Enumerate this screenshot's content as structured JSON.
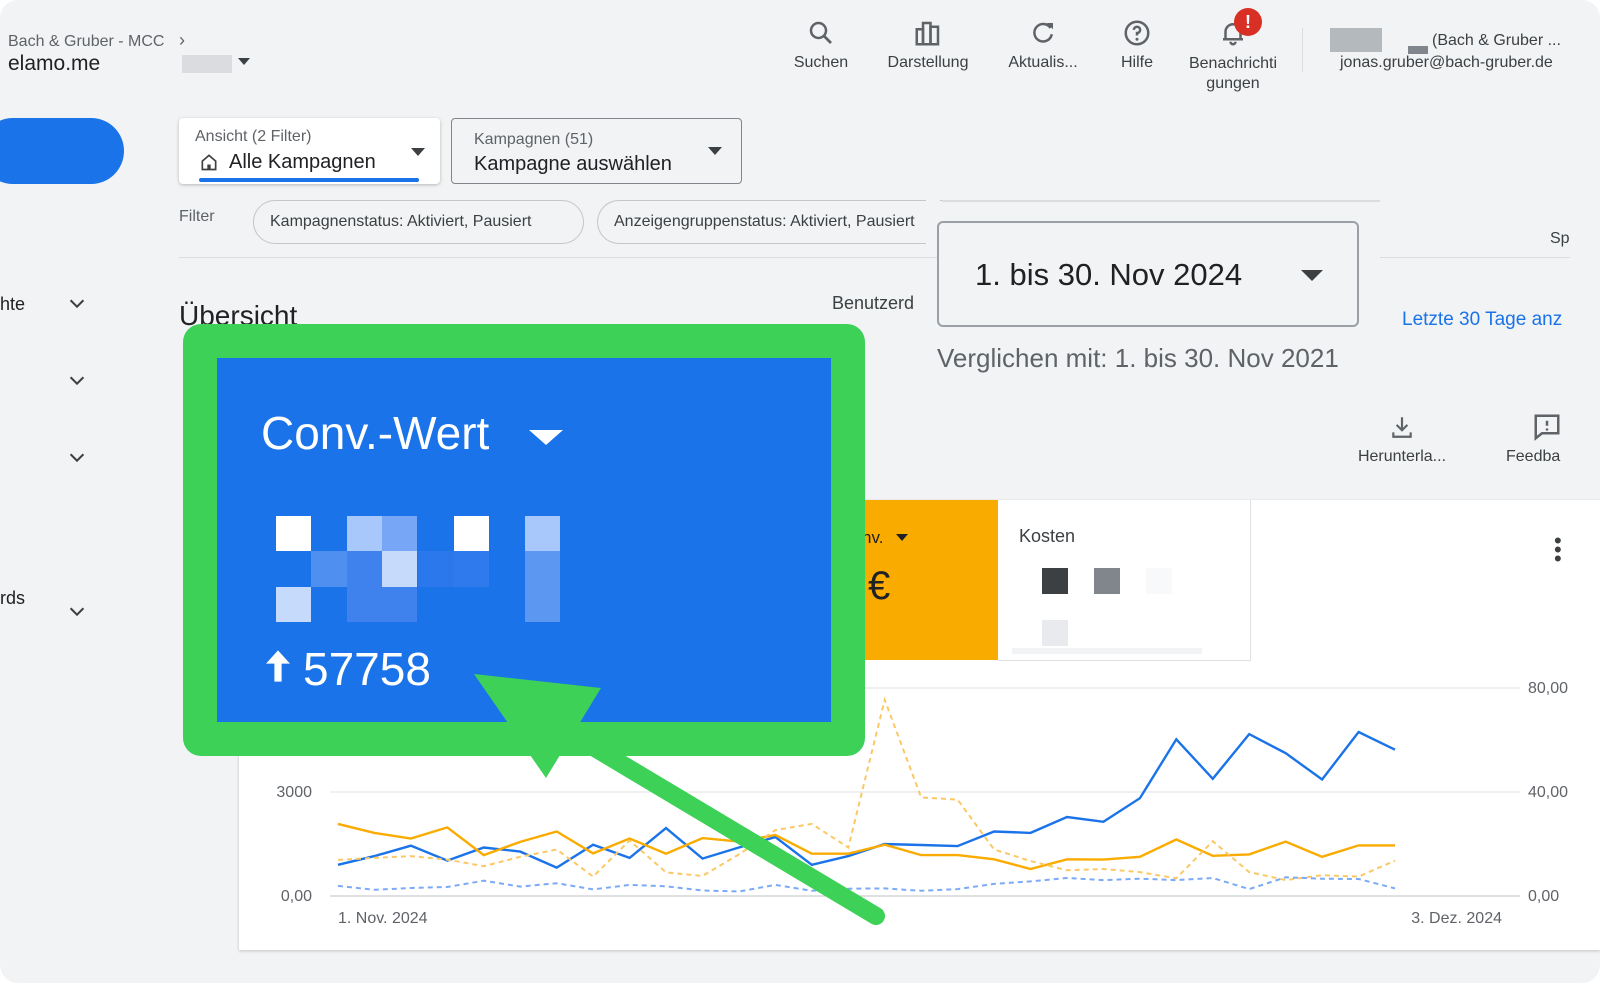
{
  "header": {
    "breadcrumb": "Bach & Gruber - MCC",
    "account": "elamo.me",
    "tools": [
      {
        "label": "Suchen",
        "icon": "search-icon"
      },
      {
        "label": "Darstellung",
        "icon": "appearance-icon"
      },
      {
        "label": "Aktualis...",
        "icon": "refresh-icon"
      },
      {
        "label": "Hilfe",
        "icon": "help-icon"
      },
      {
        "label": "Benachrichti gungen",
        "icon": "bell-icon",
        "badge": "!"
      }
    ],
    "user_name": "(Bach & Gruber ...",
    "user_email": "jonas.gruber@bach-gruber.de"
  },
  "view_select": {
    "label": "Ansicht (2 Filter)",
    "value": "Alle Kampagnen"
  },
  "campaign_select": {
    "label": "Kampagnen (51)",
    "value": "Kampagne auswählen"
  },
  "filter": {
    "label": "Filter",
    "chips": [
      "Kampagnenstatus: Aktiviert, Pausiert",
      "Anzeigengruppenstatus: Aktiviert, Pausiert"
    ],
    "trailing": "Sp"
  },
  "sidebar": {
    "items": [
      "hte",
      "",
      "",
      "rds"
    ]
  },
  "overview": {
    "title": "Übersicht",
    "custom_label": "Benutzerd",
    "date_range": "1. bis 30. Nov 2024",
    "compare": "Verglichen mit: 1. bis 30. Nov 2021",
    "last30_link": "Letzte 30 Tage anz",
    "download": "Herunterla...",
    "feedback": "Feedba"
  },
  "cards": {
    "conv_partial": "nv.",
    "currency": "€",
    "cost_label": "Kosten"
  },
  "highlight": {
    "metric": "Conv.-Wert",
    "delta": "57758"
  },
  "chart_data": {
    "type": "line",
    "x_start_label": "1. Nov. 2024",
    "x_end_label": "3. Dez. 2024",
    "y_left_ticks": [
      "0,00",
      "3000"
    ],
    "y_right_ticks": [
      "0,00",
      "40,00",
      "80,00"
    ],
    "points": 30,
    "series": [
      {
        "color": "#1a73e8",
        "dash": false,
        "values": [
          900,
          1150,
          1450,
          1020,
          1400,
          1280,
          820,
          1480,
          1100,
          1960,
          1080,
          1400,
          1700,
          900,
          1150,
          1500,
          1470,
          1440,
          1860,
          1820,
          2280,
          2140,
          2820,
          4520,
          3380,
          4670,
          4120,
          3360,
          4730,
          4220
        ]
      },
      {
        "color": "#f9ab00",
        "dash": false,
        "values": [
          2080,
          1820,
          1660,
          1980,
          1180,
          1560,
          1860,
          1230,
          1660,
          1220,
          1670,
          1570,
          1760,
          1220,
          1220,
          1480,
          1180,
          1180,
          1060,
          780,
          1060,
          1050,
          1130,
          1630,
          1160,
          1200,
          1570,
          1130,
          1460,
          1460
        ]
      },
      {
        "color": "#fbc866",
        "dash": true,
        "values": [
          1040,
          1100,
          1150,
          1050,
          860,
          1130,
          1340,
          560,
          1600,
          680,
          580,
          1200,
          1900,
          2080,
          1400,
          5660,
          2840,
          2780,
          1340,
          1010,
          740,
          780,
          690,
          510,
          1580,
          690,
          460,
          600,
          560,
          1020
        ]
      },
      {
        "color": "#7baaf7",
        "dash": true,
        "values": [
          290,
          180,
          230,
          260,
          440,
          270,
          370,
          190,
          320,
          280,
          160,
          130,
          320,
          150,
          210,
          220,
          150,
          200,
          350,
          420,
          520,
          460,
          500,
          460,
          520,
          200,
          540,
          500,
          490,
          220
        ]
      }
    ]
  }
}
